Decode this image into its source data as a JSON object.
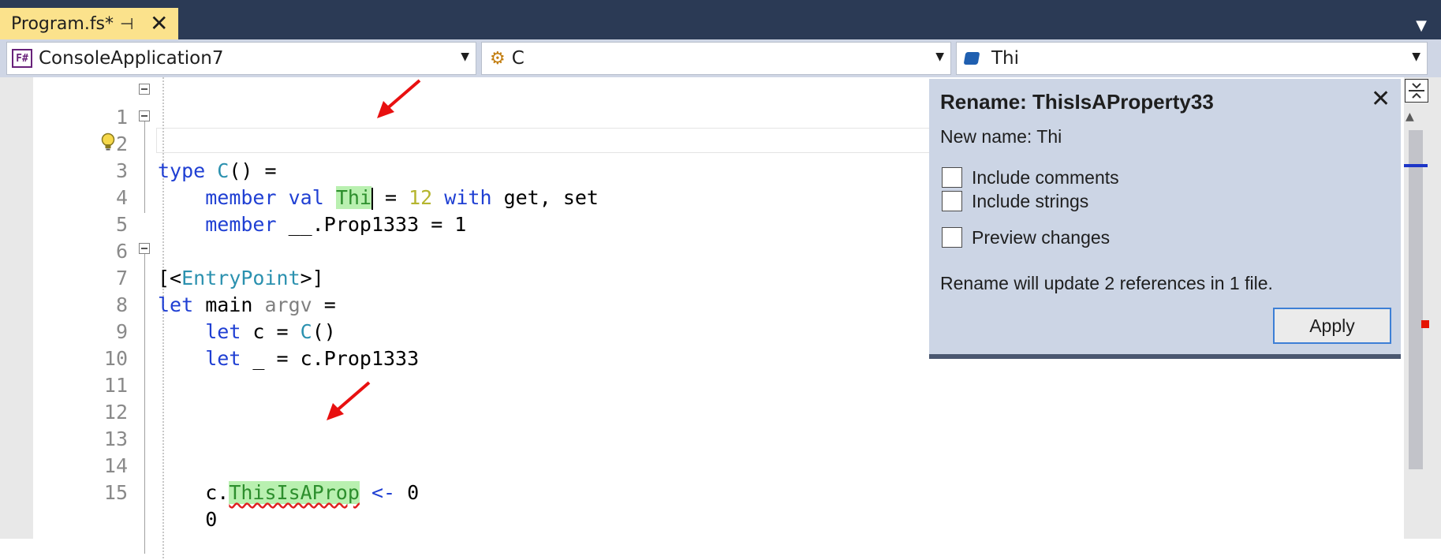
{
  "tab": {
    "title": "Program.fs*",
    "pin_icon": "pin-icon",
    "close_glyph": "✕"
  },
  "navbar": {
    "project": "ConsoleApplication7",
    "type": "C",
    "member": "Thi"
  },
  "editor": {
    "line_numbers": [
      "1",
      "2",
      "3",
      "4",
      "5",
      "6",
      "7",
      "8",
      "9",
      "10",
      "11",
      "12",
      "13",
      "14",
      "15"
    ],
    "tokens": {
      "l2_type": "type",
      "l2_c": "C",
      "l2_rest": "() =",
      "l3_member": "member",
      "l3_val": "val",
      "l3_thi": "Thi",
      "l3_eq": " = ",
      "l3_12": "12",
      "l3_with": "with",
      "l3_rest": " get, set",
      "l4_member": "member",
      "l4_rest": " __.Prop1333 = 1",
      "l6_open": "[<",
      "l6_attr": "EntryPoint",
      "l6_close": ">]",
      "l7_let": "let",
      "l7_main": " main ",
      "l7_argv": "argv",
      "l7_rest": " =",
      "l8_let": "let",
      "l8_mid": " c = ",
      "l8_c": "C",
      "l8_rest": "()",
      "l9_let": "let",
      "l9_rest": " _ = c.Prop1333",
      "l14_c": "c.",
      "l14_prop": "ThisIsAProp",
      "l14_arrow": " <- ",
      "l14_rest": "0",
      "l15": "0"
    }
  },
  "rename": {
    "title": "Rename: ThisIsAProperty33",
    "new_name": "New name: Thi",
    "include_comments": "Include comments",
    "include_strings": "Include strings",
    "preview_changes": "Preview changes",
    "status": "Rename will update 2 references in 1 file.",
    "apply": "Apply",
    "close_glyph": "✕"
  },
  "colors": {
    "tab_active": "#fbe28c",
    "chrome": "#2b3a55",
    "highlight": "#b9f0b0",
    "annotation_arrow": "#e81010"
  }
}
